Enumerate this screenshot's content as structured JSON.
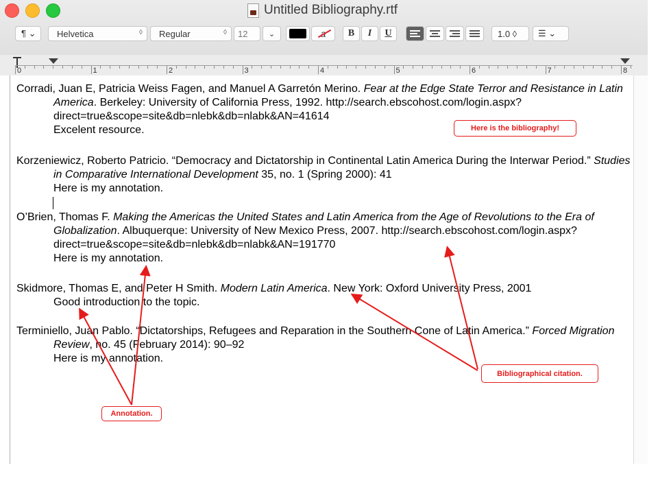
{
  "window": {
    "title": "Untitled Bibliography.rtf"
  },
  "toolbar": {
    "paragraph_symbol": "¶ ⌄",
    "font_family": "Helvetica",
    "font_style": "Regular",
    "font_size": "12",
    "bold": "B",
    "italic": "I",
    "underline": "U",
    "line_spacing": "1.0 ◊",
    "list_symbol": "☰ ⌄",
    "bg_color_glyph": "a",
    "text_color": "#000000"
  },
  "ruler": {
    "numbers": [
      "0",
      "1",
      "2",
      "3",
      "4",
      "5",
      "6",
      "7",
      "8"
    ]
  },
  "entries": [
    {
      "plain1": "Corradi, Juan E, Patricia Weiss Fagen, and Manuel A Garretón Merino. ",
      "italic1": "Fear at the Edge State Terror and Resistance in Latin America",
      "plain2": ". Berkeley: University of California Press, 1992. http://search.ebscohost.com/login.aspx?direct=true&scope=site&db=nlebk&db=nlabk&AN=41614",
      "italic2": "",
      "plain3": "",
      "note": "Excelent resource."
    },
    {
      "plain1": "Korzeniewicz, Roberto Patricio. “Democracy and Dictatorship in Continental Latin America During the Interwar Period.” ",
      "italic1": "Studies in Comparative International Development",
      "plain2": " 35, no. 1 (Spring 2000): 41",
      "italic2": "",
      "plain3": "",
      "note": "Here is my annotation."
    },
    {
      "plain1": "O’Brien, Thomas F. ",
      "italic1": "Making the Americas the United States and Latin America from the Age of Revolutions to the Era of Globalization",
      "plain2": ". Albuquerque: University of New Mexico Press, 2007. http://search.ebscohost.com/login.aspx?direct=true&scope=site&db=nlebk&db=nlabk&AN=191770",
      "italic2": "",
      "plain3": "",
      "note": "Here is my annotation."
    },
    {
      "plain1": "Skidmore, Thomas E, and Peter H Smith. ",
      "italic1": "Modern Latin America",
      "plain2": ". New York: Oxford University Press, 2001",
      "italic2": "",
      "plain3": "",
      "note": "Good introduction to the topic."
    },
    {
      "plain1": "Terminiello, Juan Pablo. “Dictatorships, Refugees and Reparation in the Southern Cone of Latin America.” ",
      "italic1": "Forced Migration Review",
      "plain2": ", no. 45 (February 2014): 90–92",
      "italic2": "",
      "plain3": "",
      "note": "Here is my annotation."
    }
  ],
  "callouts": {
    "bibliography": "Here is the bibliography!",
    "citation": "Bibliographical citation.",
    "annotation": "Annotation."
  },
  "colors": {
    "callout": "#e51c1c",
    "close": "#fc5f57",
    "minimize": "#fdbc2e",
    "zoom": "#28c840"
  }
}
